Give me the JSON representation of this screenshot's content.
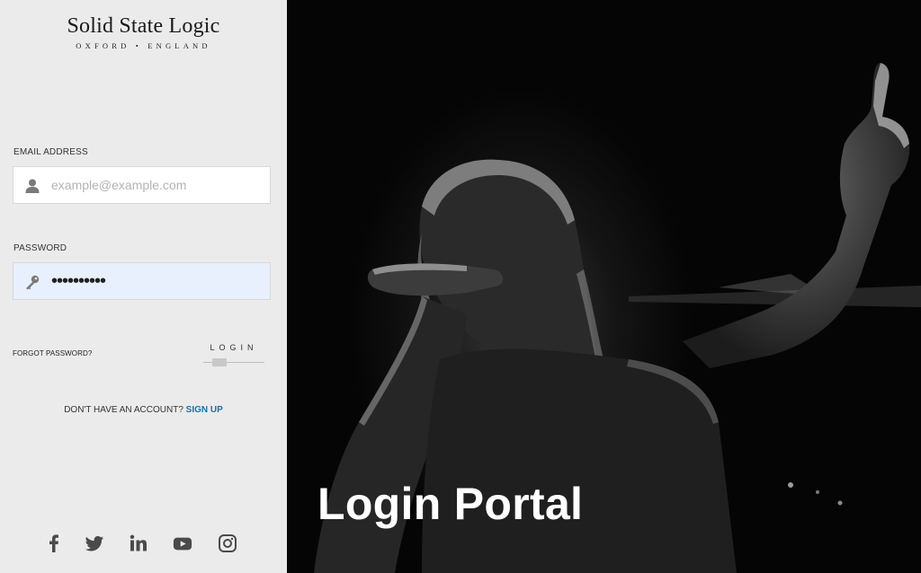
{
  "brand": {
    "name": "Solid State Logic",
    "tagline": "OXFORD • ENGLAND"
  },
  "form": {
    "email_label": "EMAIL ADDRESS",
    "email_placeholder": "example@example.com",
    "email_value": "",
    "password_label": "PASSWORD",
    "password_value": "••••••••••",
    "forgot_link": "FORGOT PASSWORD?",
    "login_button": "LOGIN",
    "signup_prompt": "DON'T HAVE AN ACCOUNT?",
    "signup_link": "SIGN UP"
  },
  "social": [
    {
      "icon": "facebook-icon"
    },
    {
      "icon": "twitter-icon"
    },
    {
      "icon": "linkedin-icon"
    },
    {
      "icon": "youtube-icon"
    },
    {
      "icon": "instagram-icon"
    }
  ],
  "hero": {
    "title": "Login Portal"
  },
  "colors": {
    "panel_bg": "#ebebeb",
    "link_accent": "#1e6ea8",
    "autofill_bg": "#e8f0fe"
  }
}
